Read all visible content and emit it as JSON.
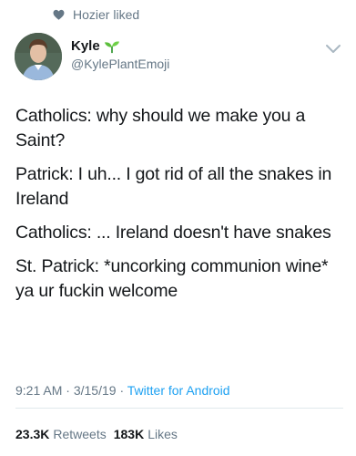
{
  "liked_by": {
    "text": "Hozier liked",
    "icon": "heart-icon"
  },
  "author": {
    "display_name": "Kyle",
    "handle": "@KylePlantEmoji",
    "name_emoji": "sprout-icon"
  },
  "tweet": {
    "lines": [
      "Catholics: why should we make you a Saint?",
      "Patrick: I uh... I got rid of all the snakes in Ireland",
      "Catholics: ... Ireland doesn't have snakes",
      "St. Patrick: *uncorking communion wine* ya ur fuckin welcome"
    ]
  },
  "meta": {
    "time": "9:21 AM",
    "date": "3/15/19",
    "separator": "·",
    "source": "Twitter for Android"
  },
  "stats": {
    "retweets_count": "23.3K",
    "retweets_label": "Retweets",
    "likes_count": "183K",
    "likes_label": "Likes"
  },
  "colors": {
    "muted": "#657786",
    "link": "#1da1f2",
    "text": "#14171a"
  }
}
